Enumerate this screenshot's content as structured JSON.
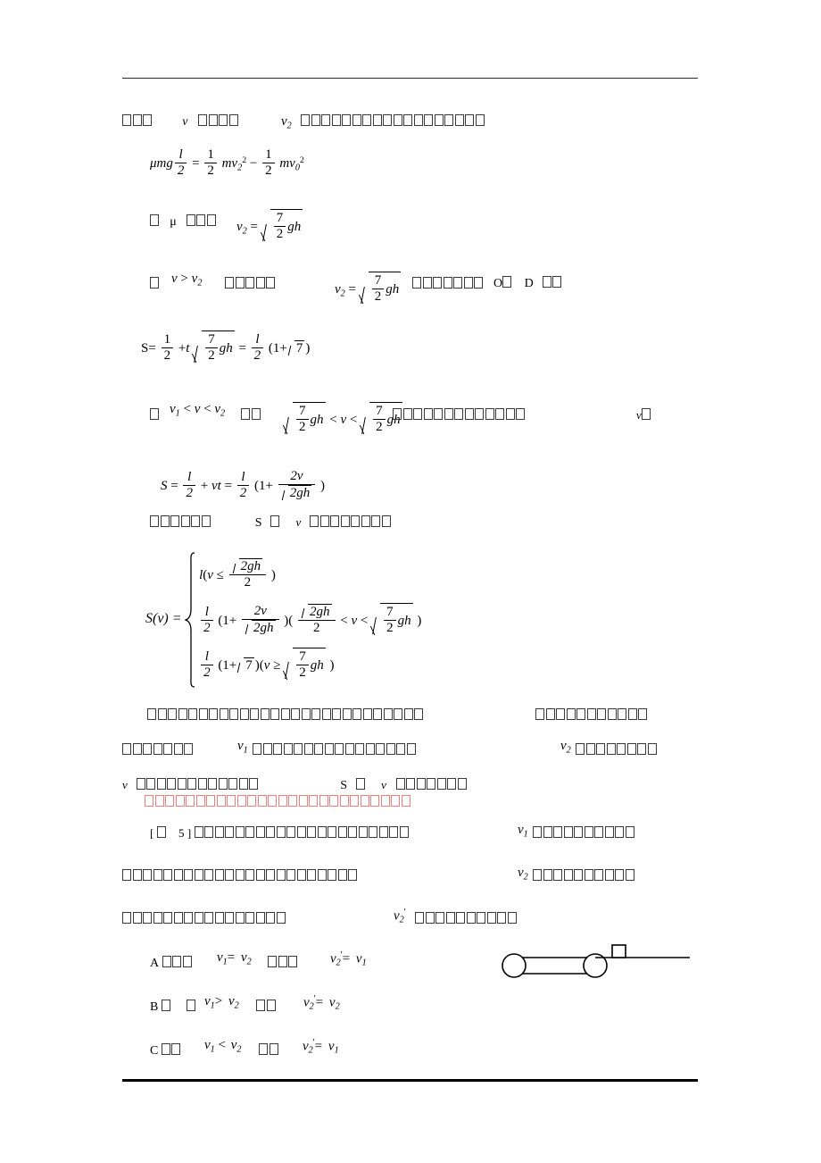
{
  "document": {
    "type": "physics-worksheet-page",
    "language": "chinese-unrendered-tofu",
    "text_color": "#000000",
    "accent_color": "#ff3b30"
  },
  "lines": {
    "l1_a": "□□□",
    "l1_v": "v",
    "l1_b": "□□□□",
    "l1_v2": "v₂",
    "l1_c": "□□□□□□□□□□□□□□□□□□"
  },
  "equations": {
    "eq1": "μmg·l/2 = ½mv₂² − ½mv₀²",
    "eq2_prefix": "□ μ □□□",
    "eq2": "v₂ = √(7/2·gh)",
    "eq3_prefix": "□",
    "eq3_cond": "v > v₂",
    "eq3_mid": "□□□□□",
    "eq3": "v₂ = √(7/2·gh)",
    "eq3_tail": "□□□□□□□",
    "eq3_OD_O": "O",
    "eq3_OD_sep": "□",
    "eq3_OD_D": "D",
    "eq3_OD_tail": "□□",
    "eq4": "S= 1/2 + t√(7/2·gh) = l/2(1+√7)",
    "eq5_prefix": "□",
    "eq5_cond": "v₁ < v < v₂",
    "eq5_mid": "□□",
    "eq5_range": "√(7/2·gh) < v < √(7/2·gh)",
    "eq5_tail": "□□□□□□□□□□□□□",
    "eq5_far": "v□",
    "eq6": "S = l/2 + vt = l/2(1 + 2v/√(2gh))",
    "l7_a": "□□□□□□",
    "l7_S": "S",
    "l7_b": "□",
    "l7_v": "v",
    "l7_c": "□□□□□□□□"
  },
  "piecewise": {
    "label": "S(v) =",
    "case1": "l (v ≤ √(2gh)/2)",
    "case2": "l/2(1 + 2v/√(2gh)) ( √(2gh)/2 < v < √(7/2·gh) )",
    "case3": "l/2(1+√7) (v ≥ √(7/2·gh))"
  },
  "paragraphs": {
    "p1_left": "□□□□□□□□□□□□□□□□□□□□□□□□□□□",
    "p1_right": "□□□□□□□□□□□",
    "p2_left": "□□□□□□□",
    "p2_v1": "v₁",
    "p2_mid": "□□□□□□□□□□□□□□□□",
    "p2_right_v2": "v₂",
    "p2_right_tail": "□□□□□□□□",
    "p3_v": "v",
    "p3_a": "□□□□□□□□□□□□",
    "p3_S": "S",
    "p3_b": "□",
    "p3_v2": "v",
    "p3_c": "□□□□□□□",
    "p4_red": "□□□□□□□□□□□□□□□□□□□□□□□□□□"
  },
  "question": {
    "marker_open": "[",
    "marker_box": "□",
    "marker_num": "5",
    "marker_close": "]",
    "q1_text": "□□□□□□□□□□□□□□□□□□□□□",
    "q1_v1": "v₁",
    "q1_tail": "□□□□□□□□□□",
    "q2_text": "□□□□□□□□□□□□□□□□□□□□□□□",
    "q2_v2": "v₂",
    "q2_tail": "□□□□□□□□□□",
    "q3_text": "□□□□□□□□□□□□□□□□",
    "q3_v2p": "v₂'",
    "q3_tail": "□□□□□□□□□□"
  },
  "options": [
    {
      "key": "A",
      "boxes": "□□□",
      "cond": "v₁ = v₂",
      "boxes2": "□□□",
      "result": "v₂' = v₁"
    },
    {
      "key": "B",
      "boxes": "□ □",
      "cond": "v₁ > v₂",
      "boxes2": "□□",
      "result": "v₂' = v₂"
    },
    {
      "key": "C",
      "boxes": "□□",
      "cond": "v₁ < v₂",
      "boxes2": "□□",
      "result": "v₂' = v₁"
    }
  ],
  "figure": {
    "name": "conveyor-belt-diagram",
    "elements": [
      "left-pulley",
      "right-pulley",
      "belt-top",
      "belt-bottom",
      "block",
      "ground-line"
    ]
  }
}
